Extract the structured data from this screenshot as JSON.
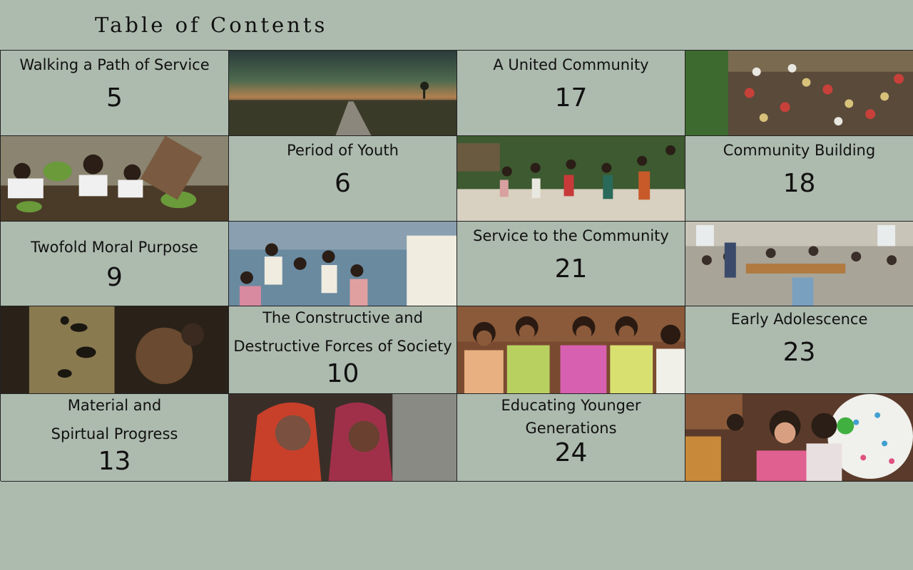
{
  "page": {
    "title": "Table of Contents"
  },
  "toc": [
    {
      "line1": "Walking a Path of Service",
      "line2": "",
      "page": "5"
    },
    {
      "line1": "A United Community",
      "line2": "",
      "page": "17"
    },
    {
      "line1": "Period of Youth",
      "line2": "",
      "page": "6"
    },
    {
      "line1": "Community Building",
      "line2": "",
      "page": "18"
    },
    {
      "line1": "Twofold Moral Purpose",
      "line2": "",
      "page": "9"
    },
    {
      "line1": "Service to the Community",
      "line2": "",
      "page": "21"
    },
    {
      "line1": "The Constructive and",
      "line2": "Destructive Forces of Society",
      "page": "10"
    },
    {
      "line1": "Early Adolescence",
      "line2": "",
      "page": "23"
    },
    {
      "line1": "Material and",
      "line2": "Spirtual Progress",
      "page": "13"
    },
    {
      "line1": "Educating Younger",
      "line2": "Generations",
      "page": "24"
    }
  ]
}
